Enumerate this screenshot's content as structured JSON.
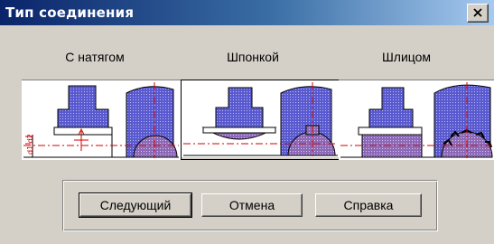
{
  "window": {
    "title": "Тип соединения",
    "close_icon": "close-icon"
  },
  "options": [
    {
      "label": "С натягом",
      "image": "interference-fit-diagram",
      "selected": false
    },
    {
      "label": "Шпонкой",
      "image": "key-joint-diagram",
      "selected": true
    },
    {
      "label": "Шлицом",
      "image": "spline-joint-diagram",
      "selected": false
    }
  ],
  "buttons": {
    "next": "Следующий",
    "cancel": "Отмена",
    "help": "Справка"
  },
  "colors": {
    "titlebar_start": "#0a246a",
    "titlebar_end": "#a6caf0",
    "shaft_fill": "#6f6fd8",
    "hub_fill": "#9a86c9",
    "centerline": "#d00000"
  }
}
